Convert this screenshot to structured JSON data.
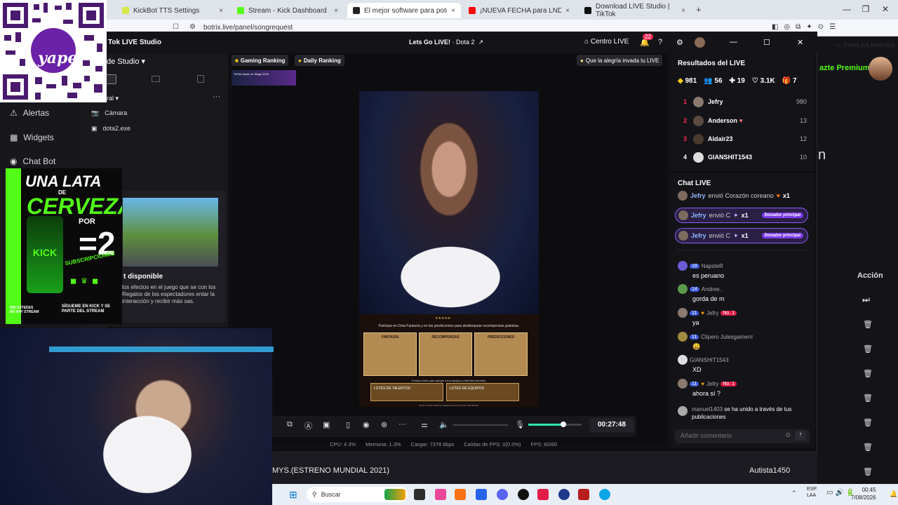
{
  "browser": {
    "tabs": [
      {
        "label": "KickBot TTS Settings",
        "color": "#d6e84a"
      },
      {
        "label": "Stream - Kick Dashboard",
        "color": "#53fc18"
      },
      {
        "label": "El mejor software para potencia",
        "color": "#222222"
      },
      {
        "label": "¡NUEVA FECHA para LNDZ!",
        "color": "#ff0000"
      },
      {
        "label": "Download LIVE Studio | TikTok",
        "color": "#111111"
      }
    ],
    "tab_close": "×",
    "new_tab": "+",
    "url": "botrix.live/panel/songrequest",
    "bookmark": "Todos los favoritos"
  },
  "qr": {
    "brand": "yape"
  },
  "kick_ad": {
    "line1": "UNA LATA",
    "line2": "DE",
    "line3": "CERVEZA",
    "line4": "POR",
    "eq": "=2",
    "line5": "SUBSCRIPCIONES",
    "brand": "KICK",
    "footer_left": "SIN USTEDES NO HAY STREAM",
    "footer_right": "SÍGUEME EN KICK Y SE PARTE DEL STREAM"
  },
  "page_behind": {
    "sidebar": [
      {
        "label": "Alertas",
        "icon": "warning-icon"
      },
      {
        "label": "Widgets",
        "icon": "widgets-icon"
      },
      {
        "label": "Chat Bot",
        "icon": "bot-icon"
      }
    ],
    "premium": "azte Premium",
    "partial_letter": "n",
    "accion": "Acción",
    "song_title": "MYS.(ESTRENO MUNDIAL 2021)",
    "song_user": "Autista1450"
  },
  "studio": {
    "title": "Tok LIVE Studio",
    "live_title": "Lets Go LIVE!",
    "live_game": "Dota 2",
    "centro_live": "Centro LIVE",
    "notif_count": "22",
    "studio_label": "de Studio",
    "section_label": "ral",
    "scenes": [
      {
        "label": "Cámara",
        "icon": "camera-icon"
      },
      {
        "label": "dota2.exe",
        "icon": "window-icon"
      }
    ],
    "game_card": {
      "title": "t disponible",
      "desc": "los efectos en el juego que se con los Regalos de los espectadores entar la interacción y recibir más sas."
    },
    "gaming_ranking": "Gaming Ranking",
    "daily_ranking": "Daily Ranking",
    "alegria": "Que la alegría invada tu LIVE",
    "mini_text": "TikTok Music on Stage 2024",
    "dota": {
      "line": "Participa en Dota Fantasía y en las predicciones para desbloquear recompensas gratuitas.",
      "cards": [
        "FANTASÍA",
        "RECOMPENSAS",
        "PREDICCIONES"
      ],
      "sub": "Compra lotes para apoyar a tus equipos y talentos favoritos.",
      "btns": [
        "LOTES DE TALENTOS",
        "LOTES DE EQUIPOS"
      ],
      "foot": "El 25 % de las ventas se destina al premio de The International."
    },
    "timer": "00:27:48",
    "stats": {
      "cpu": "CPU: 4.3%",
      "mem": "Memoria: 1.3%",
      "load": "Cargar: 7378 kbps",
      "drop": "Caídas de FPS: 0(0.0%)",
      "fps": "FPS: 60/60"
    }
  },
  "results": {
    "title": "Resultados del LIVE",
    "diamonds": "981",
    "viewers": "56",
    "follows": "19",
    "likes": "3.1K",
    "gifts": "7",
    "ranking": [
      {
        "rank": "1",
        "name": "Jefry",
        "value": "980",
        "color": "#8a7a70"
      },
      {
        "rank": "2",
        "name": "Anderson",
        "value": "13",
        "color": "#5a4a40"
      },
      {
        "rank": "3",
        "name": "Aldair23",
        "value": "12",
        "color": "#4a3a30"
      },
      {
        "rank": "4",
        "name": "GIANSHIT1543",
        "value": "10",
        "color": "#dddddd"
      }
    ]
  },
  "chat": {
    "title": "Chat LIVE",
    "gifts": [
      {
        "name": "Jefry",
        "text": "envió Corazón coreano",
        "count": "x1",
        "donor": ""
      },
      {
        "name": "Jefry",
        "text": "envió C",
        "count": "x1",
        "donor": "Donador principal"
      },
      {
        "name": "Jefry",
        "text": "envió C",
        "count": "x1",
        "donor": "Donador principal"
      }
    ],
    "messages": [
      {
        "level": "18",
        "name": "NapsteR",
        "text": "es peruano",
        "color": "#6b5bd6",
        "top": false
      },
      {
        "level": "14",
        "name": "Andree..",
        "text": "gorda de m",
        "color": "#5a9a4a",
        "top": false
      },
      {
        "level": "11",
        "name": "Jefry",
        "text": "ya",
        "color": "#8a7a70",
        "top": true
      },
      {
        "level": "11",
        "name": "Clipero Julesgamerrr",
        "text": "😄",
        "color": "#a08a40",
        "top": false
      },
      {
        "level": "",
        "name": "GIANSHIT1543",
        "text": "XD",
        "color": "#dddddd",
        "top": false
      },
      {
        "level": "11",
        "name": "Jefry",
        "text": "ahora sí ?",
        "color": "#8a7a70",
        "top": true
      },
      {
        "level": "",
        "name": "manuel1403",
        "text": "se ha unido a través de tus publicaciones",
        "color": "#aaaaaa",
        "top": false
      }
    ],
    "top_label": "No. 1",
    "input_placeholder": "Añadir comentario"
  },
  "taskbar": {
    "search": "Buscar",
    "lang1": "ESP",
    "lang2": "LAA",
    "time": "00:45",
    "date": "7/08/2026"
  },
  "colors": {
    "accent_pink": "#fe2c55",
    "kick_green": "#53fc18",
    "mic_level": "#2ee6b2"
  }
}
